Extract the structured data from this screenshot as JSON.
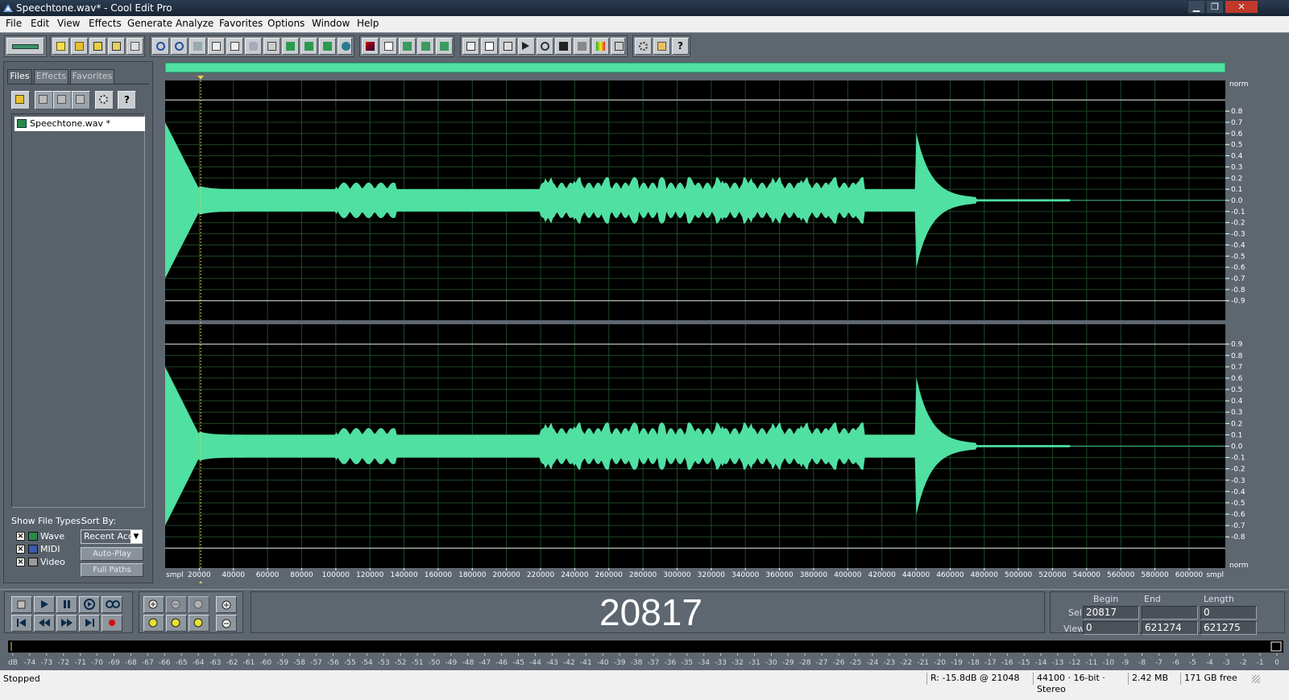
{
  "window": {
    "title": "Speechtone.wav* - Cool Edit Pro"
  },
  "menu": [
    "File",
    "Edit",
    "View",
    "Effects",
    "Generate",
    "Analyze",
    "Favorites",
    "Options",
    "Window",
    "Help"
  ],
  "left_panel": {
    "tabs": [
      "Files",
      "Effects",
      "Favorites"
    ],
    "files": [
      "Speechtone.wav *"
    ],
    "show_file_types_label": "Show File Types:",
    "sort_by_label": "Sort By:",
    "sort_value": "Recent Acc",
    "types": [
      {
        "label": "Wave",
        "checked": true
      },
      {
        "label": "MIDI",
        "checked": true
      },
      {
        "label": "Video",
        "checked": true
      }
    ],
    "checkmark": "×",
    "auto_play_label": "Auto-Play",
    "full_paths_label": "Full Paths"
  },
  "waveform": {
    "color": "#4fe0a2",
    "scale_unit": "norm",
    "amp_ticks_top": [
      "0.8",
      "0.7",
      "0.6",
      "0.5",
      "0.4",
      "0.3",
      "0.2",
      "0.1",
      "0.0",
      "-0.1",
      "-0.2",
      "-0.3",
      "-0.4",
      "-0.5",
      "-0.6",
      "-0.7",
      "-0.8",
      "-0.9"
    ],
    "amp_ticks_bottom": [
      "0.9",
      "0.8",
      "0.7",
      "0.6",
      "0.5",
      "0.4",
      "0.3",
      "0.2",
      "0.1",
      "0.0",
      "-0.1",
      "-0.2",
      "-0.3",
      "-0.4",
      "-0.5",
      "-0.6",
      "-0.7",
      "-0.8"
    ],
    "time_unit": "smpl",
    "time_ticks": [
      "20000",
      "40000",
      "60000",
      "80000",
      "100000",
      "120000",
      "140000",
      "160000",
      "180000",
      "200000",
      "220000",
      "240000",
      "260000",
      "280000",
      "300000",
      "320000",
      "340000",
      "360000",
      "380000",
      "400000",
      "420000",
      "440000",
      "460000",
      "480000",
      "500000",
      "520000",
      "540000",
      "560000",
      "580000",
      "600000"
    ],
    "total_samples": 621275,
    "cursor_sample": 20817
  },
  "time_display": "20817",
  "selection": {
    "headers": [
      "Begin",
      "End",
      "Length"
    ],
    "sel_label": "Sel",
    "view_label": "View",
    "sel": [
      "20817",
      "",
      "0"
    ],
    "view": [
      "0",
      "621274",
      "621275"
    ]
  },
  "meter": {
    "ticks": [
      "dB",
      "-74",
      "-73",
      "-72",
      "-71",
      "-70",
      "-69",
      "-68",
      "-67",
      "-66",
      "-65",
      "-64",
      "-63",
      "-62",
      "-61",
      "-60",
      "-59",
      "-58",
      "-57",
      "-56",
      "-55",
      "-54",
      "-53",
      "-52",
      "-51",
      "-50",
      "-49",
      "-48",
      "-47",
      "-46",
      "-45",
      "-44",
      "-43",
      "-42",
      "-41",
      "-40",
      "-39",
      "-38",
      "-37",
      "-36",
      "-35",
      "-34",
      "-33",
      "-32",
      "-31",
      "-30",
      "-29",
      "-28",
      "-27",
      "-26",
      "-25",
      "-24",
      "-23",
      "-22",
      "-21",
      "-20",
      "-19",
      "-18",
      "-17",
      "-16",
      "-15",
      "-14",
      "-13",
      "-12",
      "-11",
      "-10",
      "-9",
      "-8",
      "-7",
      "-6",
      "-5",
      "-4",
      "-3",
      "-2",
      "-1",
      "0"
    ]
  },
  "status": {
    "state": "Stopped",
    "reading": "R: -15.8dB @ 21048",
    "format": "44100 · 16-bit · Stereo",
    "size": "2.42 MB",
    "free": "171 GB free"
  }
}
